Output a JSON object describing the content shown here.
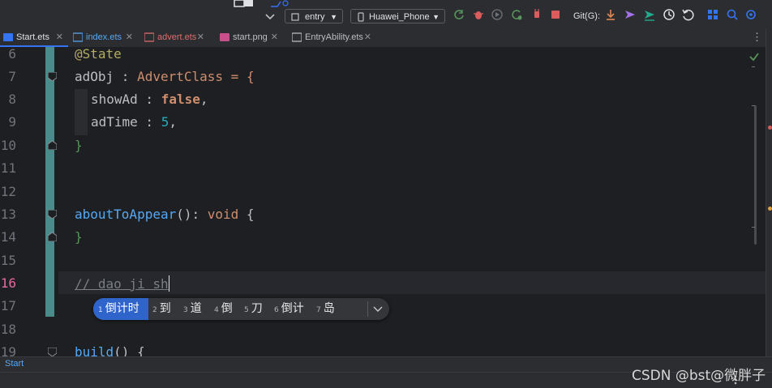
{
  "toolbar": {
    "run_config": "entry",
    "device": "Huawei_Phone",
    "git_label": "Git(G):"
  },
  "tabs": [
    {
      "label": "Start.ets",
      "active": true
    },
    {
      "label": "index.ets",
      "active": false
    },
    {
      "label": "advert.ets",
      "active": false,
      "color": "#e06c6c"
    },
    {
      "label": "start.png",
      "active": false
    },
    {
      "label": "EntryAbility.ets",
      "active": false
    }
  ],
  "editor": {
    "line_numbers": [
      "6",
      "7",
      "8",
      "9",
      "10",
      "11",
      "12",
      "13",
      "14",
      "15",
      "16",
      "17",
      "18",
      "19"
    ],
    "current_line": "16",
    "lines": {
      "l6_decorator": "@State",
      "l7_name": "adObj",
      "l7_colon": " : ",
      "l7_type": "AdvertClass",
      "l7_eq": " = {",
      "l8_key": "showAd",
      "l8_colon": " : ",
      "l8_val": "false",
      "l8_comma": ",",
      "l9_key": "adTime",
      "l9_colon": " : ",
      "l9_val": "5",
      "l9_comma": ",",
      "l10_close": "}",
      "l13_fn": "aboutToAppear",
      "l13_paren": "(): ",
      "l13_void": "void",
      "l13_brace": " {",
      "l14_close": "}",
      "l16_comment": "// dao ji sh",
      "l19_fn": "build",
      "l19_rest": "() {"
    }
  },
  "ime": {
    "candidates": [
      {
        "index": "1",
        "text": "倒计时",
        "selected": true
      },
      {
        "index": "2",
        "text": "到"
      },
      {
        "index": "3",
        "text": "道"
      },
      {
        "index": "4",
        "text": "倒"
      },
      {
        "index": "5",
        "text": "刀"
      },
      {
        "index": "6",
        "text": "倒计"
      },
      {
        "index": "7",
        "text": "岛"
      }
    ],
    "expand_icon": "chevron-down-icon"
  },
  "statusbar": {
    "breadcrumb": "Start",
    "watermark": "CSDN @bst@微胖子"
  },
  "colors": {
    "accent": "#3574f0",
    "background": "#1e1f22",
    "gutter_highlight": "#4a8c8c"
  }
}
